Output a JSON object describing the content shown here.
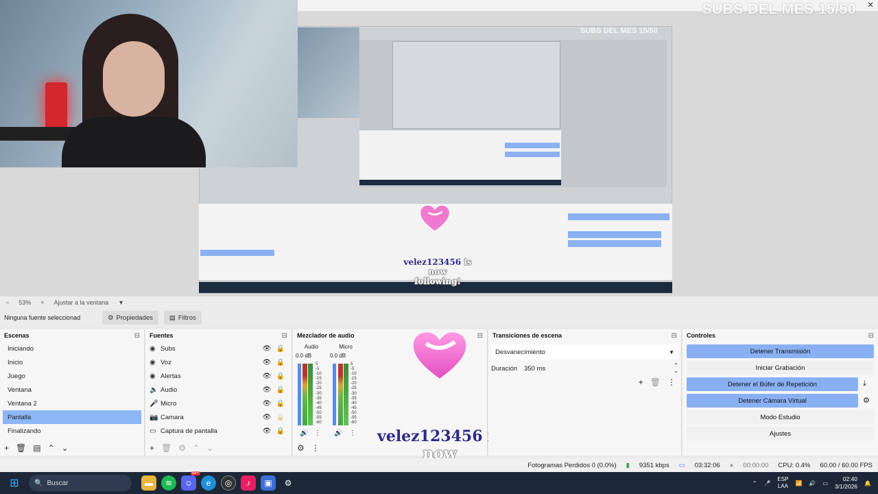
{
  "overlay": {
    "title": "SUBS DEL MES 15/50",
    "nested_title": "SUBS DEL MES 15/50",
    "follow_name": "velez123456",
    "follow_rest_1": "is now",
    "follow_rest_2": "following!"
  },
  "zoombar": {
    "minus": "−",
    "zoom": "53%",
    "plus": "+",
    "fit": "Ajustar a la ventana",
    "caret": "▼"
  },
  "source_bar": {
    "no_source": "Ninguna fuente seleccionad",
    "properties": "Propiedades",
    "filters": "Filtros"
  },
  "scenes": {
    "title": "Escenas",
    "items": [
      "Iniciando",
      "Inicio",
      "Juego",
      "Ventana",
      "Ventana 2",
      "Pantalla",
      "Finalizando"
    ],
    "selected": "Pantalla"
  },
  "sources": {
    "title": "Fuentes",
    "items": [
      {
        "label": "Subs",
        "icon": "◉"
      },
      {
        "label": "Voz",
        "icon": "◉"
      },
      {
        "label": "Alertas",
        "icon": "◉"
      },
      {
        "label": "Audio",
        "icon": "🔈"
      },
      {
        "label": "Micro",
        "icon": "🎤"
      },
      {
        "label": "Camara",
        "icon": "📷"
      },
      {
        "label": "Captura de pantalla",
        "icon": "▭"
      }
    ]
  },
  "mixer": {
    "title": "Mezclador de audio",
    "channels": [
      {
        "name": "Audio",
        "db": "0.0 dB"
      },
      {
        "name": "Micro",
        "db": "0.0 dB"
      }
    ],
    "scale": [
      "5",
      "-5",
      "-10",
      "-15",
      "-20",
      "-25",
      "-30",
      "-35",
      "-40",
      "-45",
      "-50",
      "-55",
      "-60"
    ]
  },
  "transitions": {
    "title": "Transiciones de escena",
    "selected": "Desvanecimiento",
    "duration_label": "Duración",
    "duration_value": "350 ms"
  },
  "controls": {
    "title": "Controles",
    "stop_stream": "Detener Transmisión",
    "start_recording": "Iniciar Grabación",
    "stop_replay": "Detener el Búfer de Repetición",
    "stop_vcam": "Detener Cámara Virtual",
    "studio_mode": "Modo Estudio",
    "settings": "Ajustes"
  },
  "status": {
    "dropped": "Fotogramas Perdidos 0 (0.0%)",
    "bitrate": "9351 kbps",
    "stream_time": "03:32:06",
    "rec_time": "00:00:00",
    "cpu": "CPU: 0.4%",
    "fps": "60.00 / 60.00 FPS"
  },
  "taskbar": {
    "search": "Buscar",
    "lang1": "ESP",
    "lang2": "LAA",
    "time": "02:40",
    "date": "3/1/2026",
    "badge": "99+"
  },
  "colors": {
    "selection": "#8db6f6",
    "button_blue": "#8ab0f4",
    "taskbar": "#1c2738"
  }
}
